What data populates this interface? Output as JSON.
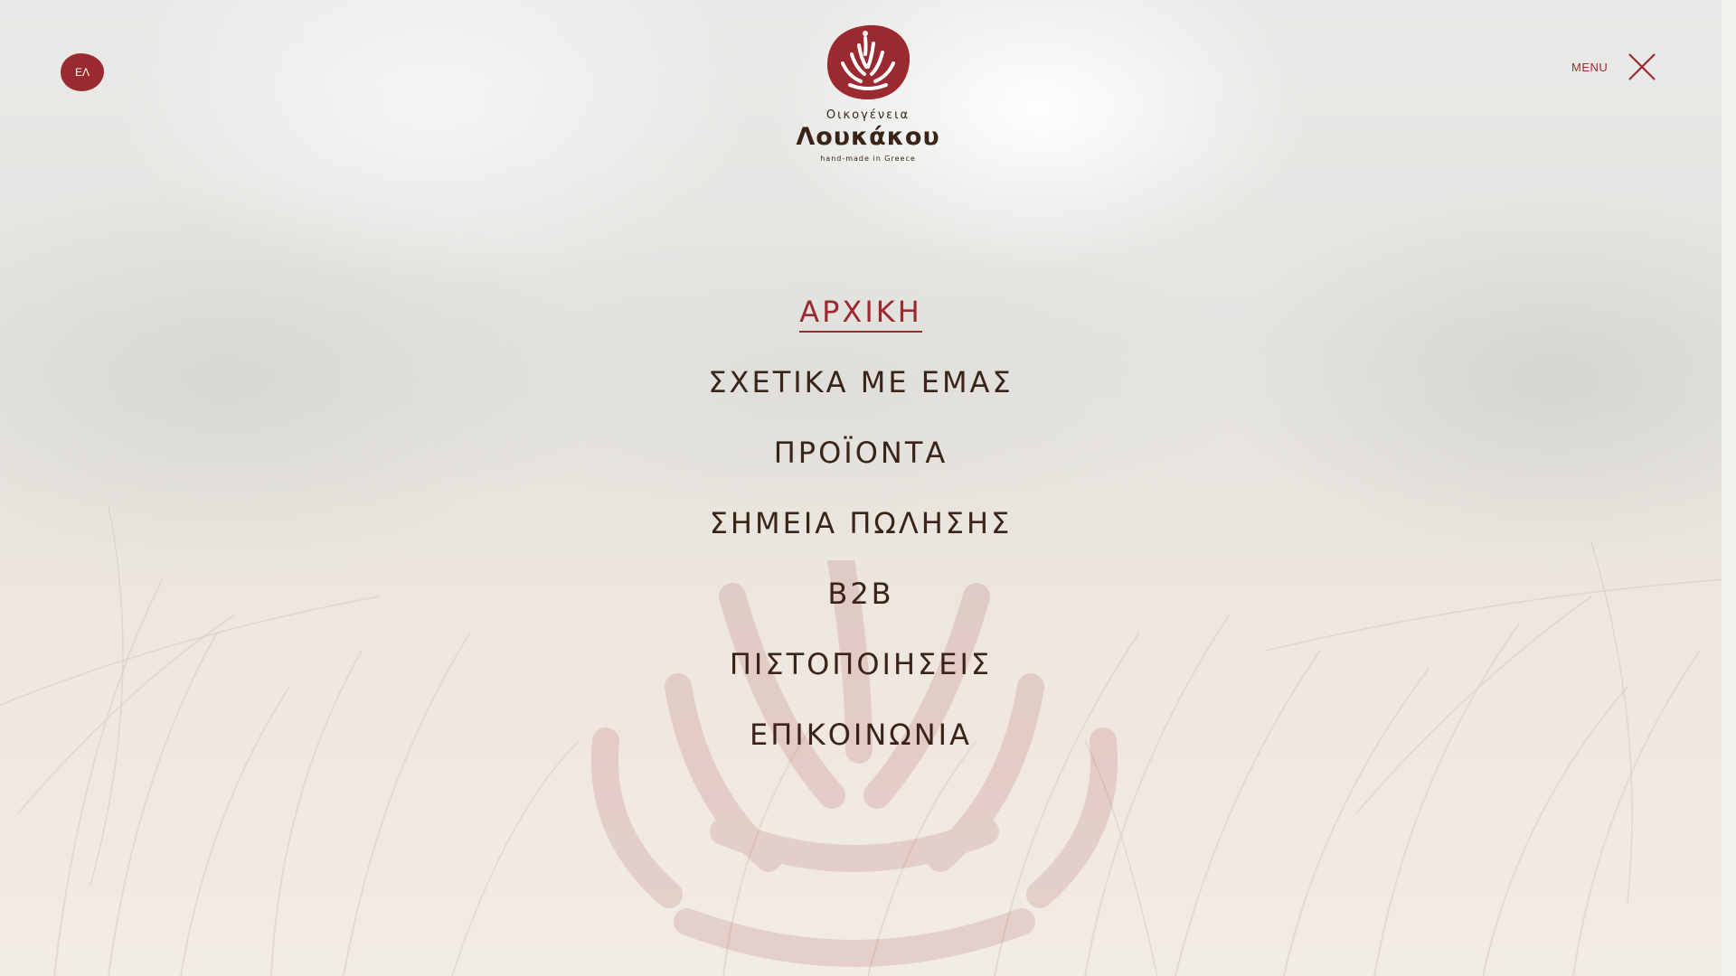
{
  "language": {
    "label": "ΕΛ"
  },
  "logo": {
    "family": "Οικογένεια",
    "name": "Λουκάκου",
    "tagline": "hand-made in Greece"
  },
  "menu": {
    "label": "MENU",
    "items": [
      {
        "label": "ΑΡΧΙΚΗ",
        "active": true
      },
      {
        "label": "ΣΧΕΤΙΚΑ ΜΕ ΕΜΑΣ",
        "active": false
      },
      {
        "label": "ΠΡΟΪΟΝΤΑ",
        "active": false
      },
      {
        "label": "ΣΗΜΕΙΑ ΠΩΛΗΣΗΣ",
        "active": false
      },
      {
        "label": "B2B",
        "active": false
      },
      {
        "label": "ΠΙΣΤΟΠΟΙΗΣΕΙΣ",
        "active": false
      },
      {
        "label": "ΕΠΙΚΟΙΝΩΝΙΑ",
        "active": false
      }
    ]
  },
  "colors": {
    "brand": "#9b2a30",
    "text": "#3a2418"
  },
  "icons": {
    "close": "close-icon",
    "logo_mark": "logo-mark-icon",
    "watermark": "watermark-icon"
  }
}
